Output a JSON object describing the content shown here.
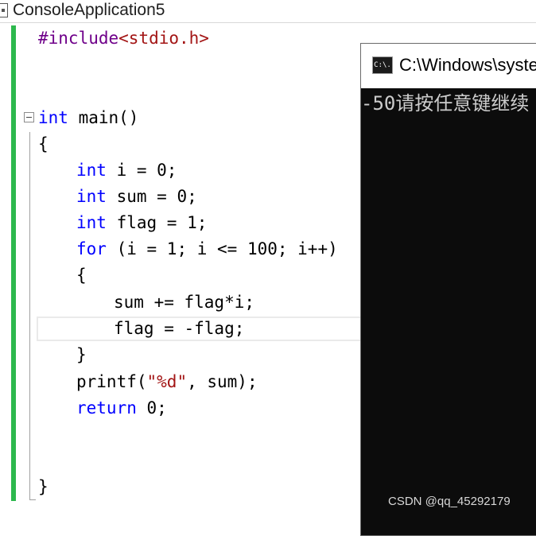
{
  "window": {
    "title": "ConsoleApplication5"
  },
  "editor": {
    "lines": [
      {
        "pp": "#include",
        "inc": "<stdio.h>"
      },
      {
        "kw": "int",
        "rest": " main()"
      },
      {
        "rest": "{"
      },
      {
        "kw": "int",
        "rest": " i = 0;"
      },
      {
        "kw": "int",
        "rest": " sum = 0;"
      },
      {
        "kw": "int",
        "rest": " flag = 1;"
      },
      {
        "kw": "for",
        "rest": " (i = 1; i <= 100; i++)"
      },
      {
        "rest": "{"
      },
      {
        "rest": "sum += flag*i;"
      },
      {
        "rest": "flag = -flag;"
      },
      {
        "rest": "}"
      },
      {
        "pre": "printf(",
        "str": "\"%d\"",
        "post": ", sum);"
      },
      {
        "kw": "return",
        "rest": " 0;"
      },
      {
        "rest": "}"
      }
    ]
  },
  "console": {
    "title": "C:\\Windows\\syste",
    "icon_text": "C:\\.",
    "output": "-50请按任意键继续"
  },
  "watermark": "CSDN @qq_45292179",
  "colors": {
    "keyword": "#0000ff",
    "preprocessor": "#6f008a",
    "string": "#a31515",
    "change_bar": "#2db84d",
    "console_bg": "#0c0c0c",
    "console_text": "#cccccc"
  }
}
